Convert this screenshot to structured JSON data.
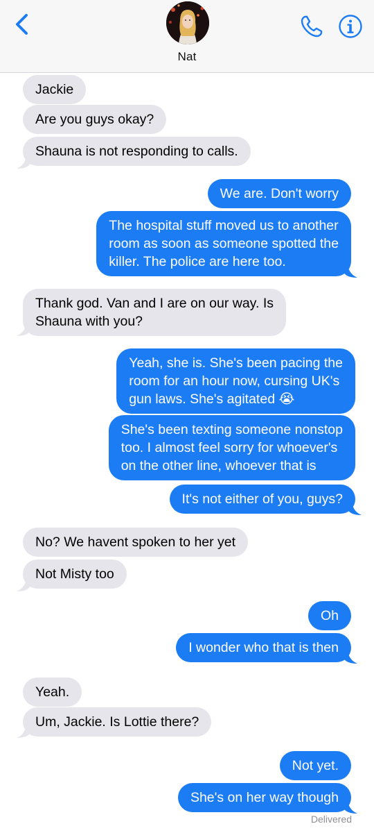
{
  "header": {
    "contact_name": "Nat"
  },
  "colors": {
    "incoming_bubble": "#e6e5eb",
    "outgoing_bubble": "#1c7cf4",
    "accent": "#1c7cf4"
  },
  "icons": {
    "back": "chevron-left-icon",
    "call": "phone-icon",
    "info": "info-icon"
  },
  "messages": [
    {
      "dir": "in",
      "lines": [
        "Jackie"
      ]
    },
    {
      "dir": "in",
      "lines": [
        "Are you guys okay?"
      ]
    },
    {
      "dir": "in",
      "lines": [
        "Shauna is not responding to calls."
      ]
    },
    {
      "dir": "out",
      "lines": [
        "We are. Don't worry"
      ]
    },
    {
      "dir": "out",
      "lines": [
        "The hospital stuff moved us to another",
        "room as soon as someone spotted the",
        "killer. The police are here too."
      ]
    },
    {
      "dir": "in",
      "lines": [
        "Thank god. Van and I are on our way. Is",
        "Shauna with you?"
      ]
    },
    {
      "dir": "out",
      "lines": [
        "Yeah, she is. She's been pacing the",
        "room for an hour now, cursing UK's",
        "gun laws. She's agitated 😭"
      ]
    },
    {
      "dir": "out",
      "lines": [
        "She's been texting someone nonstop",
        "too. I almost feel sorry for whoever's",
        "on the other line, whoever that is"
      ]
    },
    {
      "dir": "out",
      "lines": [
        "It's not either of you, guys?"
      ]
    },
    {
      "dir": "in",
      "lines": [
        "No? We havent spoken to her yet"
      ]
    },
    {
      "dir": "in",
      "lines": [
        "Not Misty too"
      ]
    },
    {
      "dir": "out",
      "lines": [
        "Oh"
      ]
    },
    {
      "dir": "out",
      "lines": [
        "I wonder who that is then"
      ]
    },
    {
      "dir": "in",
      "lines": [
        "Yeah."
      ]
    },
    {
      "dir": "in",
      "lines": [
        "Um, Jackie. Is Lottie there?"
      ]
    },
    {
      "dir": "out",
      "lines": [
        "Not yet."
      ]
    },
    {
      "dir": "out",
      "lines": [
        "She's on her way though"
      ]
    }
  ],
  "status": {
    "delivered": "Delivered"
  }
}
